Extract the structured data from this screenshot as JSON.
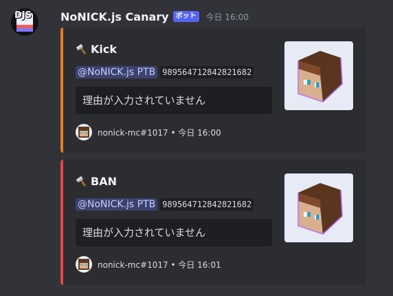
{
  "message": {
    "author": "NoNICK.js Canary",
    "badge": "ボット",
    "timestamp": "今日 16:00",
    "avatar_text": "DJS"
  },
  "embeds": [
    {
      "title": "Kick",
      "title_icon": "hammer-icon",
      "color": "#e67e22",
      "mention": "@NoNICK.js PTB",
      "user_id": "989564712842821682",
      "reason": "理由が入力されていません",
      "footer": "nonick-mc#1017 • 今日 16:00"
    },
    {
      "title": "BAN",
      "title_icon": "hammer-icon",
      "color": "#ed4245",
      "mention": "@NoNICK.js PTB",
      "user_id": "989564712842821682",
      "reason": "理由が入力されていません",
      "footer": "nonick-mc#1017 • 今日 16:01"
    }
  ]
}
